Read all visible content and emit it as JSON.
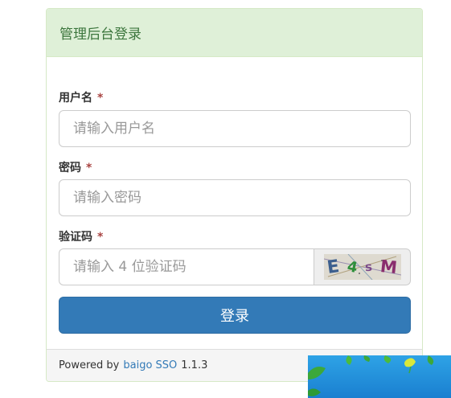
{
  "panel": {
    "heading": "管理后台登录"
  },
  "form": {
    "username": {
      "label": "用户名",
      "required_mark": "*",
      "placeholder": "请输入用户名",
      "value": ""
    },
    "password": {
      "label": "密码",
      "required_mark": "*",
      "placeholder": "请输入密码",
      "value": ""
    },
    "captcha": {
      "label": "验证码",
      "required_mark": "*",
      "placeholder": "请输入 4 位验证码",
      "value": "",
      "image_chars": [
        "E",
        "4",
        "s",
        "M"
      ]
    },
    "submit_label": "登录"
  },
  "footer": {
    "prefix": "Powered by",
    "link_text": "baigo SSO",
    "version": "1.1.3"
  },
  "colors": {
    "heading_bg": "#dff0d8",
    "heading_text": "#3c763d",
    "primary_button": "#337ab7",
    "required_mark": "#a94442",
    "link": "#337ab7",
    "desktop_corner": "#1a7fd0"
  }
}
